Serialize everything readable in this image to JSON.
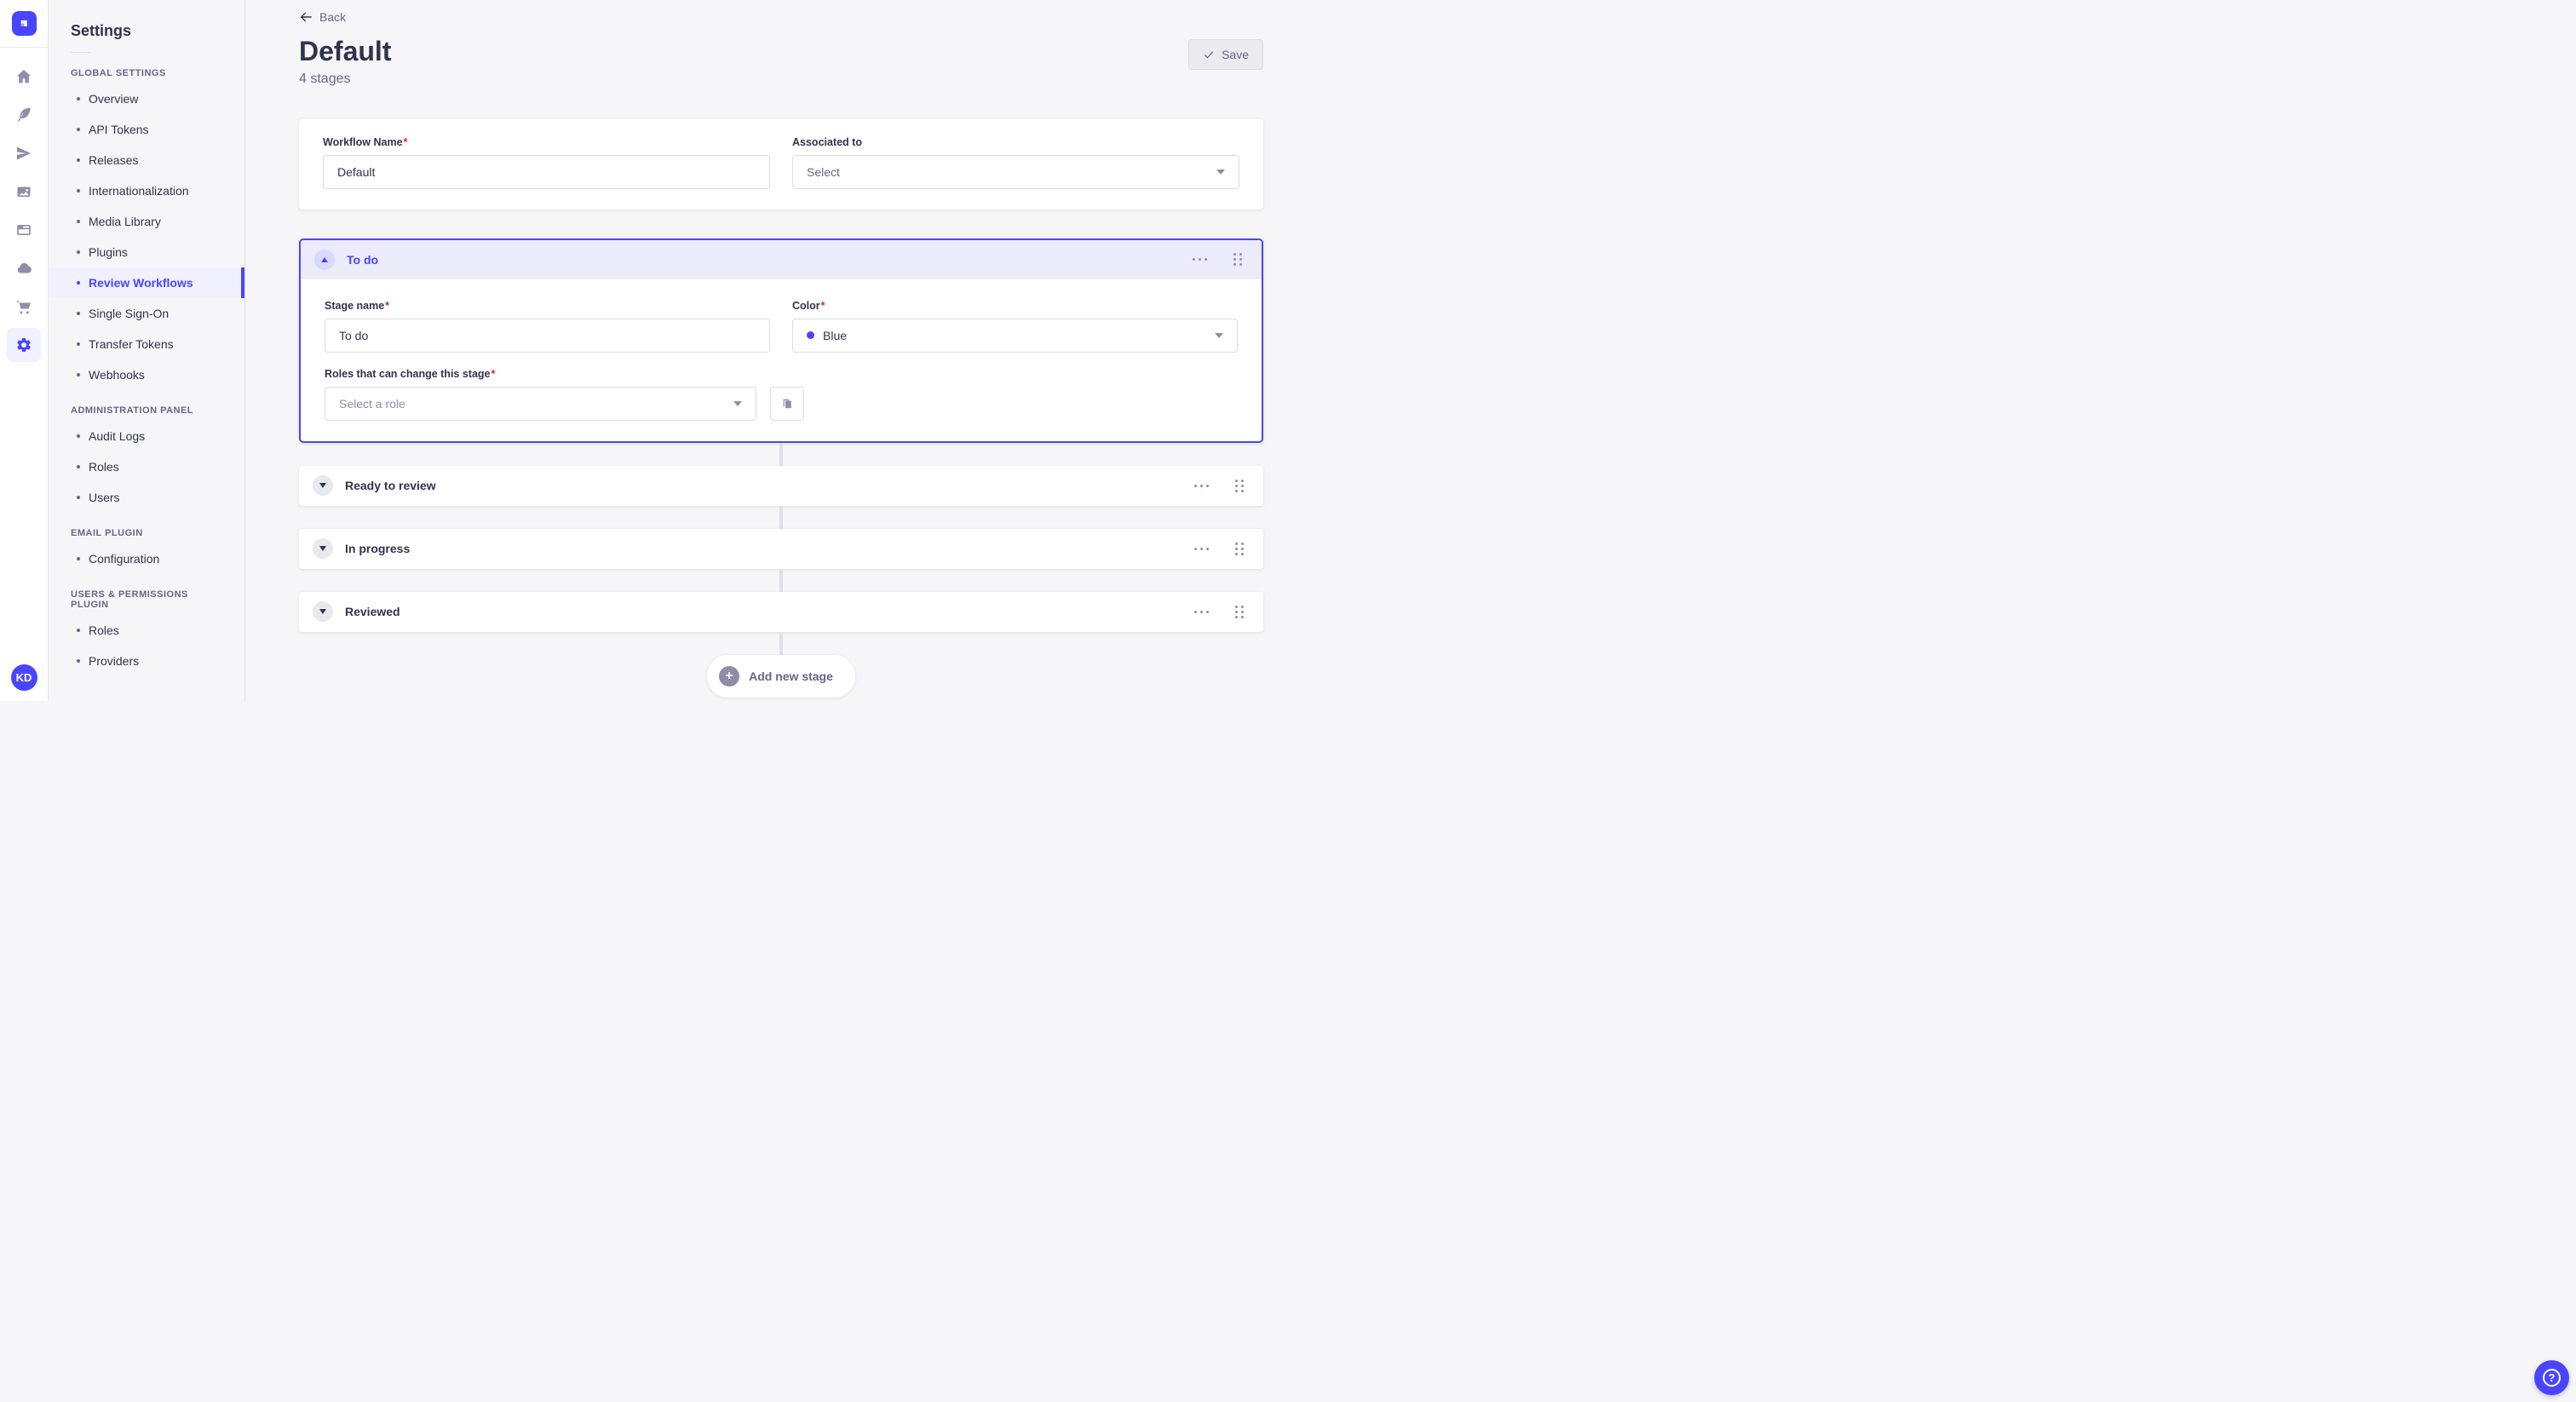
{
  "rail": {
    "logo_icon": "strapi-logo",
    "icons": [
      "home",
      "content-feather",
      "paper-plane",
      "media-images",
      "layout",
      "cloud",
      "marketplace-cart",
      "settings-gear"
    ],
    "active_icon": "settings-gear",
    "avatar_initials": "KD"
  },
  "nav": {
    "title": "Settings",
    "sections": [
      {
        "label": "GLOBAL SETTINGS",
        "items": [
          {
            "label": "Overview"
          },
          {
            "label": "API Tokens"
          },
          {
            "label": "Releases"
          },
          {
            "label": "Internationalization"
          },
          {
            "label": "Media Library"
          },
          {
            "label": "Plugins"
          },
          {
            "label": "Review Workflows",
            "active": true
          },
          {
            "label": "Single Sign-On"
          },
          {
            "label": "Transfer Tokens"
          },
          {
            "label": "Webhooks"
          }
        ]
      },
      {
        "label": "ADMINISTRATION PANEL",
        "items": [
          {
            "label": "Audit Logs"
          },
          {
            "label": "Roles"
          },
          {
            "label": "Users"
          }
        ]
      },
      {
        "label": "EMAIL PLUGIN",
        "items": [
          {
            "label": "Configuration"
          }
        ]
      },
      {
        "label": "USERS & PERMISSIONS PLUGIN",
        "items": [
          {
            "label": "Roles"
          },
          {
            "label": "Providers"
          }
        ]
      }
    ]
  },
  "header": {
    "back_label": "Back",
    "title": "Default",
    "subtitle": "4 stages",
    "save_label": "Save"
  },
  "form": {
    "workflow_name_label": "Workflow Name",
    "required_mark": "*",
    "workflow_name_value": "Default",
    "associated_to_label": "Associated to",
    "associated_to_value": "Select"
  },
  "stages": {
    "expanded": {
      "title": "To do",
      "stage_name_label": "Stage name",
      "stage_name_value": "To do",
      "color_label": "Color",
      "color_value": "Blue",
      "color_hex": "#4945ff",
      "roles_label": "Roles that can change this stage",
      "roles_placeholder": "Select a role"
    },
    "collapsed": [
      {
        "title": "Ready to review"
      },
      {
        "title": "In progress"
      },
      {
        "title": "Reviewed"
      }
    ],
    "add_button_label": "Add new stage"
  },
  "fab": {
    "icon": "help-question"
  },
  "colors": {
    "primary": "#4945ff",
    "primary_light": "#f0f0ff",
    "stage_header_bg": "#ebebfa",
    "background": "#f6f6f9",
    "border": "#dcdce4",
    "text": "#32324d",
    "text_muted": "#666687",
    "icon_gray": "#8e8ea9",
    "danger": "#d02b20"
  }
}
